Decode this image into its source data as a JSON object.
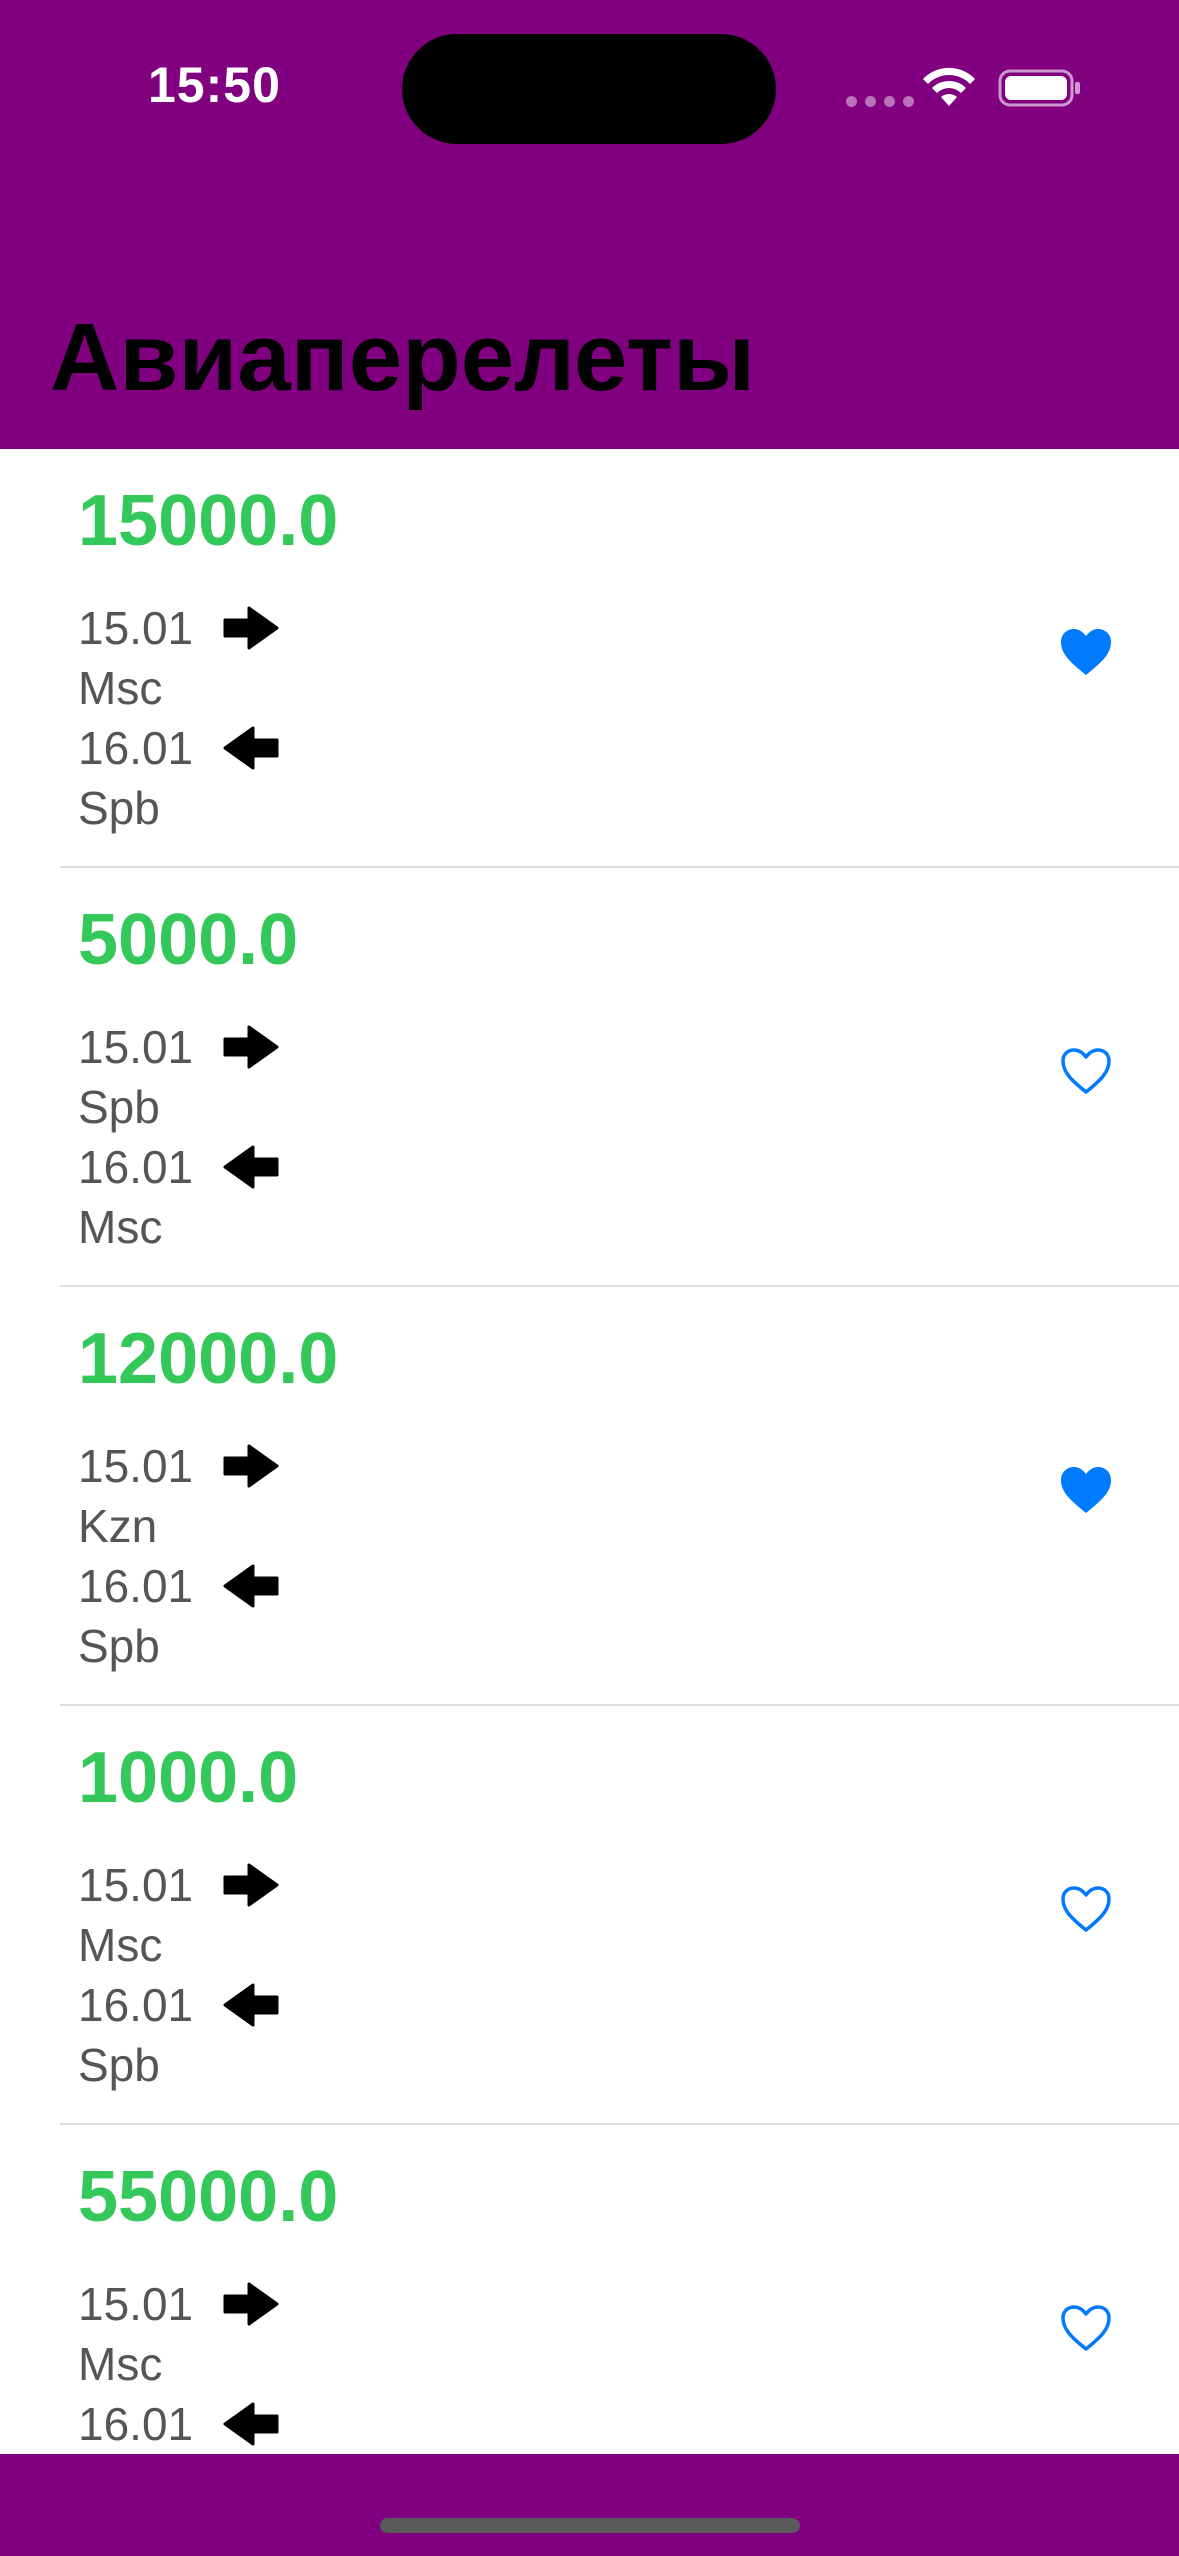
{
  "status_bar": {
    "time": "15:50"
  },
  "header": {
    "title": "Авиаперелеты",
    "background_color": "#800080"
  },
  "colors": {
    "price": "#34c759",
    "heart": "#007aff",
    "subtext": "#555555"
  },
  "flights": [
    {
      "price": "15000.0",
      "depart_date": "15.01",
      "depart_city": "Msc",
      "return_date": "16.01",
      "return_city": "Spb",
      "favorite": true
    },
    {
      "price": "5000.0",
      "depart_date": "15.01",
      "depart_city": "Spb",
      "return_date": "16.01",
      "return_city": "Msc",
      "favorite": false
    },
    {
      "price": "12000.0",
      "depart_date": "15.01",
      "depart_city": "Kzn",
      "return_date": "16.01",
      "return_city": "Spb",
      "favorite": true
    },
    {
      "price": "1000.0",
      "depart_date": "15.01",
      "depart_city": "Msc",
      "return_date": "16.01",
      "return_city": "Spb",
      "favorite": false
    },
    {
      "price": "55000.0",
      "depart_date": "15.01",
      "depart_city": "Msc",
      "return_date": "16.01",
      "return_city": "",
      "favorite": false
    }
  ],
  "icons": {
    "depart": "arrow-right-icon",
    "return": "arrow-left-icon",
    "favorite_on": "heart-filled-icon",
    "favorite_off": "heart-outline-icon"
  }
}
